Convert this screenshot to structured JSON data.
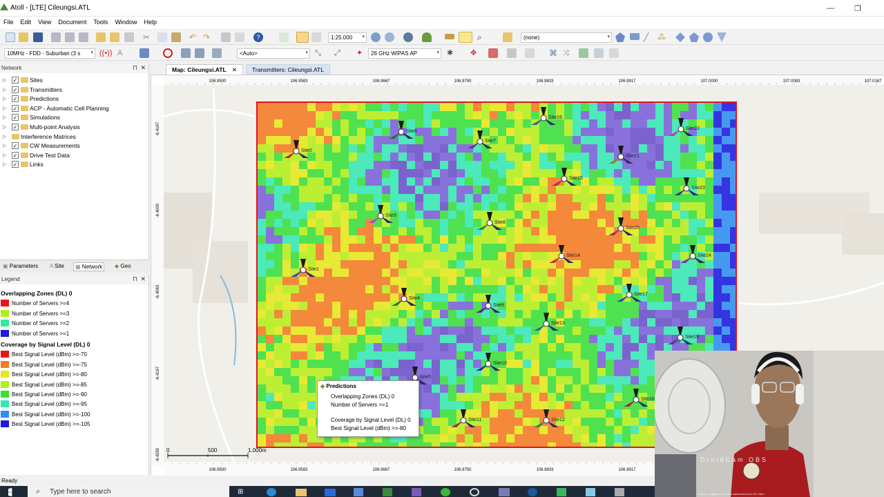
{
  "app": {
    "title": "Atoll - [LTE] Cileungsi.ATL"
  },
  "menu": [
    "File",
    "Edit",
    "View",
    "Document",
    "Tools",
    "Window",
    "Help"
  ],
  "toolbar": {
    "scale": "1:25.000",
    "layer": "(none)",
    "carrier": "10MHz - FDD - Suburban (3 s",
    "auto": "<Auto>",
    "band": "26 GHz WIPAS AP"
  },
  "network_panel": {
    "title": "Network",
    "items": [
      {
        "label": "Sites",
        "checked": true
      },
      {
        "label": "Transmitters",
        "checked": true
      },
      {
        "label": "Predictions",
        "checked": true
      },
      {
        "label": "ACP - Automatic Cell Planning",
        "checked": true
      },
      {
        "label": "Simulations",
        "checked": true
      },
      {
        "label": "Multi-point Analysis",
        "checked": true
      },
      {
        "label": "Interference Matrices",
        "checked": false
      },
      {
        "label": "CW Measurements",
        "checked": true
      },
      {
        "label": "Drive Test Data",
        "checked": true
      },
      {
        "label": "Links",
        "checked": true
      }
    ]
  },
  "explorer_tabs": [
    "Parameters",
    "Site",
    "Network",
    "Geo"
  ],
  "legend": {
    "title": "Legend",
    "sections": [
      {
        "heading": "Overlapping Zones (DL) 0",
        "items": [
          {
            "label": "Number of Servers >=4",
            "color": "#e8141c"
          },
          {
            "label": "Number of Servers >=3",
            "color": "#b4ef1a"
          },
          {
            "label": "Number of Servers >=2",
            "color": "#34e89c"
          },
          {
            "label": "Number of Servers >=1",
            "color": "#1a1ae0"
          }
        ]
      },
      {
        "heading": "Coverage by Signal Level (DL) 0",
        "items": [
          {
            "label": "Best Signal Level (dBm) >=-70",
            "color": "#e8141c"
          },
          {
            "label": "Best Signal Level (dBm) >=-75",
            "color": "#f47a22"
          },
          {
            "label": "Best Signal Level (dBm) >=-80",
            "color": "#e6e81a"
          },
          {
            "label": "Best Signal Level (dBm) >=-85",
            "color": "#b4ef1a"
          },
          {
            "label": "Best Signal Level (dBm) >=-90",
            "color": "#38df3a"
          },
          {
            "label": "Best Signal Level (dBm) >=-95",
            "color": "#34e8b4"
          },
          {
            "label": "Best Signal Level (dBm) >=-100",
            "color": "#2c8ef0"
          },
          {
            "label": "Best Signal Level (dBm) >=-105",
            "color": "#1a1ae0"
          }
        ]
      }
    ]
  },
  "doc_tabs": [
    {
      "label": "Map: Cileungsi.ATL",
      "active": true
    },
    {
      "label": "Transmitters: Cileungsi.ATL",
      "active": false
    }
  ],
  "map": {
    "x_ticks": [
      "106.9500",
      "106.9583",
      "106.9667",
      "106.9750",
      "106.9833",
      "106.9917",
      "107.0000",
      "107.0083",
      "107.0167"
    ],
    "y_ticks": [
      "-6.4167",
      "-6.4000",
      "-6.4083",
      "-6.4167",
      "-6.4250"
    ],
    "scale_labels": [
      "0",
      "500",
      "1.000m"
    ],
    "sites": [
      {
        "name": "Site0",
        "color": "#d4202a"
      },
      {
        "name": "Site6",
        "color": "#1f7a28"
      },
      {
        "name": "Site7",
        "color": "#7a2a8a"
      },
      {
        "name": "Site16",
        "color": "#2a6a8a"
      },
      {
        "name": "Site22",
        "color": "#c03aa8"
      },
      {
        "name": "Site21",
        "color": "#8a8a20"
      },
      {
        "name": "Site15",
        "color": "#b02a6a"
      },
      {
        "name": "Site23",
        "color": "#404080"
      },
      {
        "name": "Site3",
        "color": "#c040c0"
      },
      {
        "name": "Site8",
        "color": "#208a50"
      },
      {
        "name": "Site20",
        "color": "#9a3060"
      },
      {
        "name": "Site1",
        "color": "#3a4ac0"
      },
      {
        "name": "Site14",
        "color": "#c82a2a"
      },
      {
        "name": "Site24",
        "color": "#7a3a9a"
      },
      {
        "name": "Site4",
        "color": "#2a7a2a"
      },
      {
        "name": "Site9",
        "color": "#5a2a7a"
      },
      {
        "name": "Site17",
        "color": "#3050a0"
      },
      {
        "name": "Site13",
        "color": "#306aa0"
      },
      {
        "name": "Site19",
        "color": "#5a3a8a"
      },
      {
        "name": "Site10",
        "color": "#2030b0"
      },
      {
        "name": "Site5",
        "color": "#b03ab0"
      },
      {
        "name": "Site11",
        "color": "#a02a3a"
      },
      {
        "name": "Site12",
        "color": "#3a8a3a"
      },
      {
        "name": "Site18",
        "color": "#b0203a"
      }
    ]
  },
  "tooltip": {
    "title": "Predictions",
    "line1": "Overlapping Zones (DL) 0",
    "line2": "Number of Servers >=1",
    "line3": "Coverage by Signal Level (DL) 0",
    "line4": "Best Signal Level (dBm) >=-80"
  },
  "status": {
    "text": "Ready"
  },
  "taskbar": {
    "search_placeholder": "Type here to search"
  },
  "webcam": {
    "watermark": "DroidCam OBS",
    "upgrade": "Get pro upgrade to remove watermark from HD video"
  }
}
